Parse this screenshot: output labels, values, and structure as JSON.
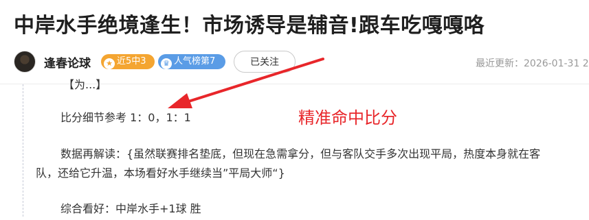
{
  "article": {
    "title": "中岸水手绝境逢生！市场诱导是辅音!跟车吃嘎嘎咯"
  },
  "author": {
    "name": "逢春论球",
    "badges": [
      {
        "icon": "star-icon",
        "label": "近5中3",
        "color": "#f4a531"
      },
      {
        "icon": "crown-icon",
        "label": "人气榜第7",
        "color": "#5a9ce6"
      }
    ],
    "follow_label": "已关注",
    "updated_text": "最近更新：2026-01-31 2"
  },
  "content": {
    "cut_heading": "【为...】",
    "score_line": "比分细节参考 1：0，1：1",
    "analysis_line1": "数据再解读：{虽然联赛排名垫底，但现在急需拿分，但与客队交手多次出现平局，热度本身就在客",
    "analysis_line2": "队，还给它升温，本场看好水手继续当”平局大师“}",
    "verdict": "综合看好：中岸水手+1球  胜"
  },
  "annotation": {
    "text": "精准命中比分",
    "color": "#e8262a"
  }
}
